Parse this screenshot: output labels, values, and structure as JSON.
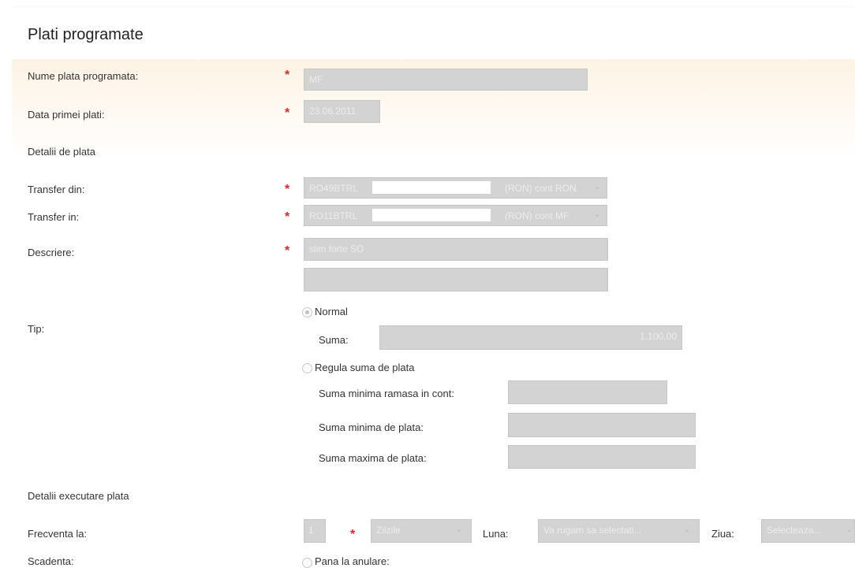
{
  "header": {
    "title": "Plati programate"
  },
  "form": {
    "nume_label": "Nume plata programata:",
    "nume_value": "MF",
    "data_label": "Data primei plati:",
    "data_value": "23.06.2011",
    "detalii_plata_heading": "Detalii de plata",
    "transfer_din_label": "Transfer din:",
    "transfer_din_iban": "RO49BTRL",
    "transfer_din_suffix": "(RON) cont RON",
    "transfer_in_label": "Transfer in:",
    "transfer_in_iban": "RO11BTRL",
    "transfer_in_suffix": "(RON) cont MF",
    "descriere_label": "Descriere:",
    "descriere_value": "slim forte SO",
    "descriere_value2": "",
    "tip_label": "Tip:",
    "radio_normal_label": "Normal",
    "suma_label": "Suma:",
    "suma_value": "1.100,00",
    "radio_regula_label": "Regula suma de plata",
    "suma_min_ramasa_label": "Suma minima ramasa in cont:",
    "suma_min_plata_label": "Suma minima de plata:",
    "suma_max_plata_label": "Suma maxima de plata:",
    "detalii_executare_heading": "Detalii executare plata",
    "frecventa_label": "Frecventa la:",
    "frecventa_value": "1",
    "frecventa_unit": "Zilzile",
    "luna_label": "Luna:",
    "luna_value": "Va rugam sa selectati...",
    "ziua_label": "Ziua:",
    "ziua_value": "Selecteaza...",
    "scadenta_label": "Scadenta:",
    "radio_pana_label": "Pana la anulare:"
  },
  "required_marker": "*",
  "icons": {
    "dropdown": "chevron-down-icon"
  },
  "colors": {
    "required": "#e0262a",
    "field_bg": "#d3d3d3",
    "band": "#fdf3e4"
  }
}
